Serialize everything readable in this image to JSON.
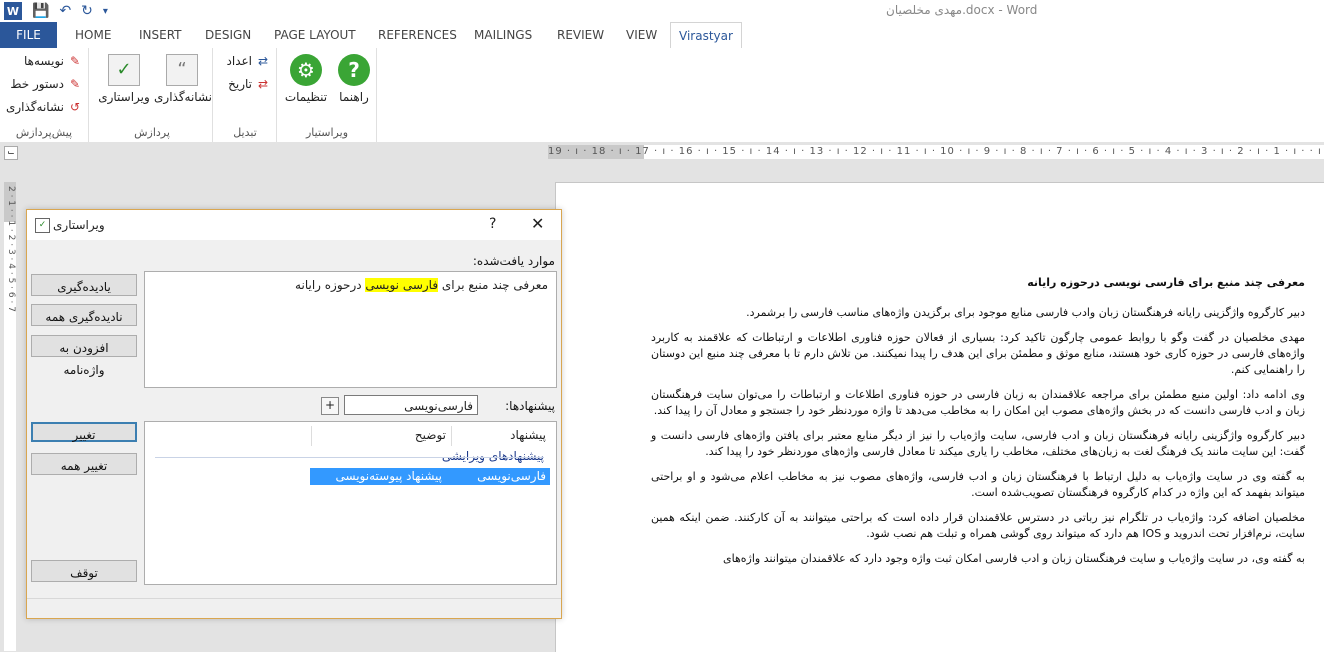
{
  "window": {
    "title": "مهدی مخلصیان.docx - Word"
  },
  "tabs": {
    "file": "FILE",
    "home": "HOME",
    "insert": "INSERT",
    "design": "DESIGN",
    "page_layout": "PAGE LAYOUT",
    "references": "REFERENCES",
    "mailings": "MAILINGS",
    "review": "REVIEW",
    "view": "VIEW",
    "virastyar": "Virastyar"
  },
  "ribbon": {
    "preprocess": {
      "label": "پیش‌پردازش",
      "writers": "نویسه‌ها",
      "script": "دستور خط",
      "marking": "نشانه‌گذاری"
    },
    "process": {
      "label": "پردازش",
      "editing": "ویراستاری",
      "punctuation": "نشانه‌گذاری"
    },
    "convert": {
      "label": "تبدیل",
      "numbers": "اعداد",
      "date": "تاریخ"
    },
    "virastyar": {
      "label": "ویراستیار",
      "settings": "تنظیمات",
      "help": "راهنما"
    }
  },
  "ruler": "19 · ı · 18 · ı · 17 · ı · 16 · ı · 15 · ı · 14 · ı · 13 · ı · 12 · ı · 11 · ı · 10 · ı · 9 · ı · 8 · ı · 7 · ı · 6 · ı · 5 · ı · 4 · ı · 3 · ı · 2 · ı · 1 · ı · · ı · 1",
  "vruler": "2 · 1 · · 1 · 2 · 3 · 4 · 5 · 6 · 7",
  "dialog": {
    "title": "ویراستاری",
    "help": "?",
    "close": "✕",
    "found_label": "موارد یافت‌شده:",
    "found_before": "معرفی چند منبع برای ",
    "found_highlight": "فارسی نویسی",
    "found_after": " درحوزه رایانه",
    "btn_learn": "یادیده‌گیری",
    "btn_ignore_all": "نادیده‌گیری همه",
    "btn_add_dict": "افزودن به واژه‌نامه",
    "suggestions_label": "پیشنهادها:",
    "suggestion_value": "فارسی‌نویسی",
    "plus": "+",
    "col_suggestion": "پیشنهاد",
    "col_description": "توضیح",
    "group_title": "پیشنهادهای ویرایشی",
    "row_suggestion": "فارسی‌نویسی",
    "row_description": "پیشنهاد پیوسته‌نویسی",
    "btn_change": "تغییر",
    "btn_change_all": "تغییر همه",
    "btn_stop": "توقف"
  },
  "document": {
    "heading": "معرفی چند منبع برای فارسی نویسی درحوزه رایانه",
    "p1": "دبیر کارگروه واژگزینی رایانه فرهنگستان زبان وادب فارسی منابع موجود برای برگزیدن واژه‌های مناسب فارسی را برشمرد.",
    "p2": "مهدی مخلصیان در گفت وگو با روابط عمومی چارگون تاکید کرد: بسیاری از فعالان حوزه فناوری اطلاعات و ارتباطات که علاقمند به کاربرد واژه‌های فارسی در حوزه کاری خود هستند، منابع موثق و مطمئن برای این هدف را پیدا نمیکنند. من تلاش دارم تا با معرفی چند منبع این دوستان را راهنمایی کنم.",
    "p3": "وی ادامه داد: اولین منبع مطمئن برای مراجعه علاقمندان به زبان فارسی در حوزه فناوری اطلاعات و ارتباطات را می‌توان سایت فرهنگستان زبان و ادب فارسی دانست که در بخش واژه‌های مصوب این امکان را به مخاطب می‌دهد تا واژه موردنظر خود را جستجو و معادل آن را پیدا کند.",
    "p4": "دبیر کارگروه واژگزینی رایانه فرهنگستان زبان و ادب فارسی، سایت واژه‌یاب را نیز از دیگر منابع معتبر برای یافتن واژه‌های فارسی دانست و گفت: این سایت مانند یک فرهنگ لغت به زبان‌های مختلف، مخاطب را یاری میکند تا معادل فارسی واژه‌های موردنظر خود را پیدا کند.",
    "p5": " به گفته وی در سایت واژه‌یاب به دلیل ارتباط با فرهنگستان زبان و ادب فارسی، واژه‌های مصوب نیز به مخاطب اعلام می‌شود و او براحتی میتواند بفهمد که این واژه در کدام کارگروه فرهنگستان تصویب‌شده است.",
    "p6": "مخلصیان اضافه کرد: واژه‌یاب در تلگرام نیز رباتی در دسترس علاقمندان قرار داده است که براحتی میتوانند به آن کارکنند. ضمن اینکه همین سایت، نرم‌افزار تحت اندروید و IOS هم دارد که میتواند روی گوشی همراه و تبلت هم نصب شود.",
    "p7": "به گفته وی، در سایت واژه‌یاب و سایت فرهنگستان زبان و ادب فارسی امکان ثبت واژه وجود دارد که علاقمندان میتوانند واژه‌های"
  }
}
